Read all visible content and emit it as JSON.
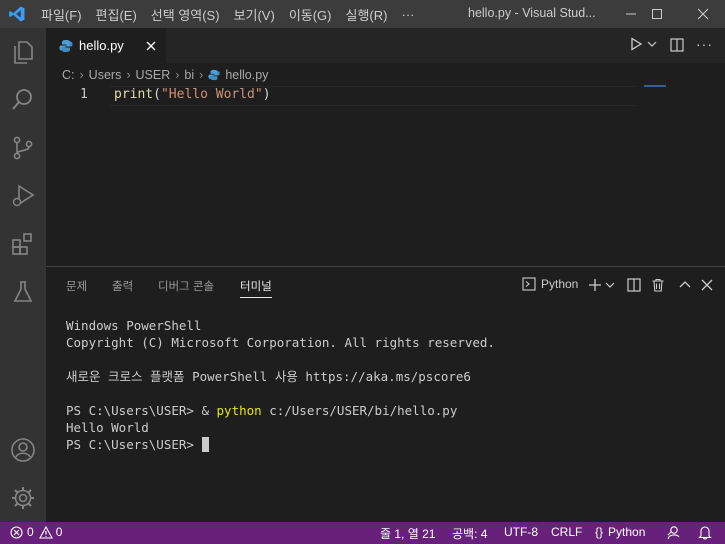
{
  "titlebar": {
    "menu": [
      "파일(F)",
      "편집(E)",
      "선택 영역(S)",
      "보기(V)",
      "이동(G)",
      "실행(R)",
      "···"
    ],
    "title": "hello.py - Visual Stud..."
  },
  "editor": {
    "tab_label": "hello.py",
    "breadcrumb": [
      "C:",
      "Users",
      "USER",
      "bi",
      "hello.py"
    ],
    "line_number": "1",
    "code_fn": "print",
    "code_open": "(",
    "code_string": "\"Hello World\"",
    "code_close": ")"
  },
  "panel": {
    "tabs": [
      "문제",
      "출력",
      "디버그 콘솔",
      "터미널"
    ],
    "active_tab": "터미널",
    "terminal_selector": "Python",
    "terminal_lines": {
      "l1": "Windows PowerShell",
      "l2": "Copyright (C) Microsoft Corporation. All rights reserved.",
      "l3": "새로운 크로스 플랫폼 PowerShell 사용 https://aka.ms/pscore6",
      "l4_prompt": "PS C:\\Users\\USER> & ",
      "l4_cmd": "python",
      "l4_arg": " c:/Users/USER/bi/hello.py",
      "l5": "Hello World",
      "l6": "PS C:\\Users\\USER> "
    }
  },
  "statusbar": {
    "errors": "0",
    "warnings": "0",
    "position": "줄 1, 열 21",
    "indent": "공백: 4",
    "encoding": "UTF-8",
    "eol": "CRLF",
    "language": "Python"
  },
  "colors": {
    "accent_status": "#68217a",
    "vscode_blue": "#3c9df5"
  }
}
